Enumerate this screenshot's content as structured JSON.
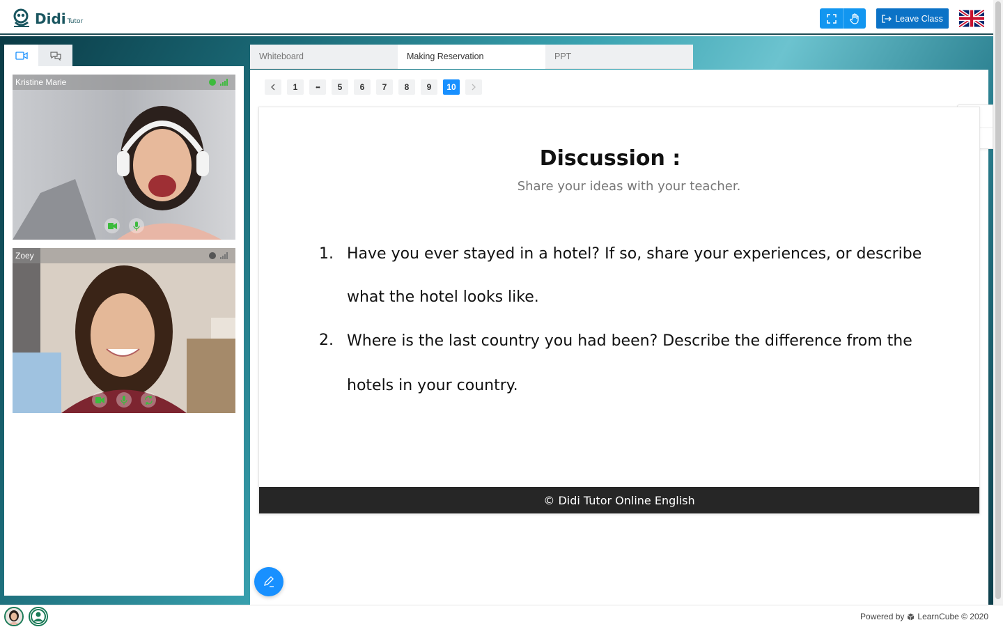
{
  "app": {
    "logo_text": "Didi",
    "logo_sub": "Tutor"
  },
  "header": {
    "leave_label": "Leave Class"
  },
  "participants": [
    {
      "name": "Kristine Marie",
      "status_color": "#3dbb3d",
      "signal_color": "#3dbb3d"
    },
    {
      "name": "Zoey",
      "status_color": "#555555",
      "signal_color": "#777777"
    }
  ],
  "tabs": [
    {
      "label": "Whiteboard",
      "active": false
    },
    {
      "label": "Making Reservation",
      "active": true
    },
    {
      "label": "PPT",
      "active": false
    }
  ],
  "pagination": {
    "pages": [
      "1",
      "•••",
      "5",
      "6",
      "7",
      "8",
      "9",
      "10"
    ],
    "current": "10"
  },
  "slide": {
    "title": "Discussion :",
    "subtitle": "Share your ideas with your teacher.",
    "questions": [
      {
        "num": "1.",
        "line1": "Have you ever stayed in a hotel? If so, share your experiences, or describe",
        "line2": "what the hotel looks like."
      },
      {
        "num": "2.",
        "line1": "Where is the last country you had been? Describe the difference from the",
        "line2": "hotels in your country."
      }
    ],
    "footer": "© Didi Tutor Online English"
  },
  "bottom": {
    "powered_prefix": "Powered by",
    "powered_brand": "LearnCube © 2020"
  },
  "colors": {
    "accent": "#1890ff",
    "leave": "#0b72c6",
    "brand": "#1a5660"
  }
}
